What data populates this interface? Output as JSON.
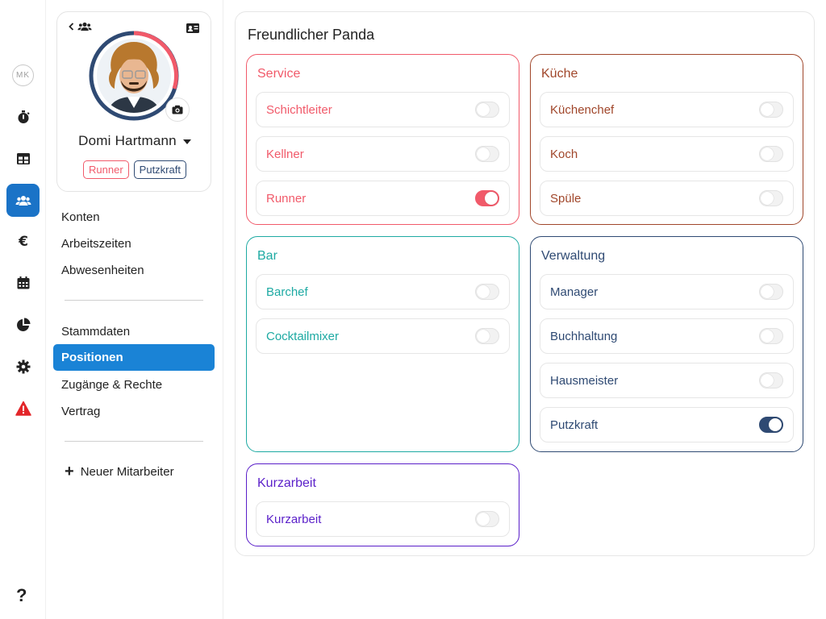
{
  "rail": {
    "avatar_initials": "MK",
    "items": [
      {
        "icon": "stopwatch-icon"
      },
      {
        "icon": "table-icon"
      },
      {
        "icon": "users-icon"
      },
      {
        "icon": "euro-icon"
      },
      {
        "icon": "calendar-icon"
      },
      {
        "icon": "pie-chart-icon"
      },
      {
        "icon": "gear-icon"
      },
      {
        "icon": "warning-icon"
      }
    ],
    "active_item": "users-icon",
    "help_label": "?"
  },
  "profile": {
    "name": "Domi Hartmann",
    "tags": [
      "Runner",
      "Putzkraft"
    ]
  },
  "sidebar": {
    "links_top": [
      "Konten",
      "Arbeitszeiten",
      "Abwesenheiten"
    ],
    "links_bottom": [
      "Stammdaten",
      "Positionen",
      "Zugänge & Rechte",
      "Vertrag"
    ],
    "active_link": "Positionen",
    "new_employee_label": "Neuer Mitarbeiter"
  },
  "main": {
    "title": "Freundlicher Panda",
    "groups": [
      {
        "title": "Service",
        "color": "#f15a6a",
        "positions": [
          {
            "label": "Schichtleiter",
            "on": false
          },
          {
            "label": "Kellner",
            "on": false
          },
          {
            "label": "Runner",
            "on": true
          }
        ]
      },
      {
        "title": "Küche",
        "color": "#a0462a",
        "positions": [
          {
            "label": "Küchenchef",
            "on": false
          },
          {
            "label": "Koch",
            "on": false
          },
          {
            "label": "Spüle",
            "on": false
          }
        ]
      },
      {
        "title": "Bar",
        "color": "#1eaaa3",
        "positions": [
          {
            "label": "Barchef",
            "on": false
          },
          {
            "label": "Cocktailmixer",
            "on": false
          }
        ]
      },
      {
        "title": "Verwaltung",
        "color": "#2f4a73",
        "positions": [
          {
            "label": "Manager",
            "on": false
          },
          {
            "label": "Buchhaltung",
            "on": false
          },
          {
            "label": "Hausmeister",
            "on": false
          },
          {
            "label": "Putzkraft",
            "on": true
          }
        ]
      },
      {
        "title": "Kurzarbeit",
        "color": "#5a1fc9",
        "positions": [
          {
            "label": "Kurzarbeit",
            "on": false
          }
        ]
      }
    ]
  }
}
